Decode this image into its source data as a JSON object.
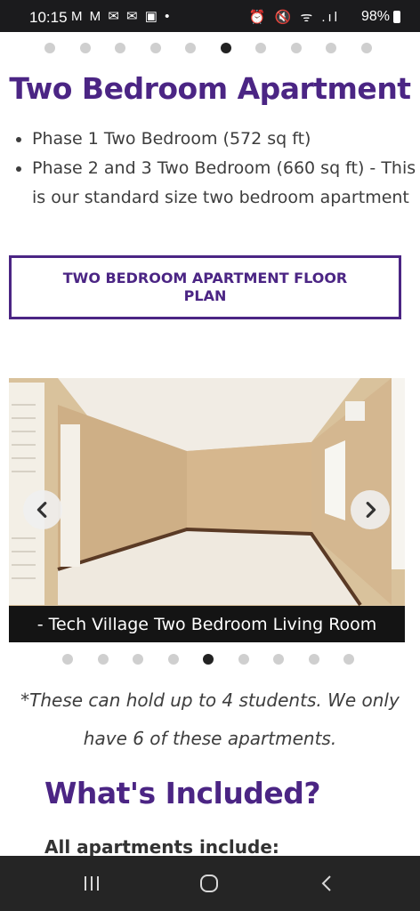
{
  "status_bar": {
    "time": "10:15",
    "notifications": "M M ✉ ✉ ▣ •",
    "system_icons": "⏰ 🔇 ᯤ .ıl",
    "battery": "98%"
  },
  "carousel_top": {
    "dot_count": 10,
    "active_index": 5
  },
  "title": "Two Bedroom Apartment",
  "features": [
    "Phase 1 Two Bedroom (572 sq ft)",
    "Phase 2 and 3 Two Bedroom (660 sq ft) - This is our standard size two bedroom apartment"
  ],
  "floor_plan_button": "TWO BEDROOM APARTMENT FLOOR PLAN",
  "photo_carousel": {
    "caption": "- Tech Village Two Bedroom Living Room",
    "dot_count": 9,
    "active_index": 4,
    "prev_icon": "chevron-left-icon",
    "next_icon": "chevron-right-icon"
  },
  "note": "*These can hold up to 4 students. We only have 6 of these apartments.",
  "included_heading": "What's Included?",
  "all_include_label": "All apartments include:",
  "nav_bar": {
    "icons": [
      "recent-apps-icon",
      "home-icon",
      "back-icon"
    ]
  },
  "colors": {
    "brand_purple": "#4b2584",
    "caption_bg": "#141414",
    "navbar_bg": "#252525"
  }
}
